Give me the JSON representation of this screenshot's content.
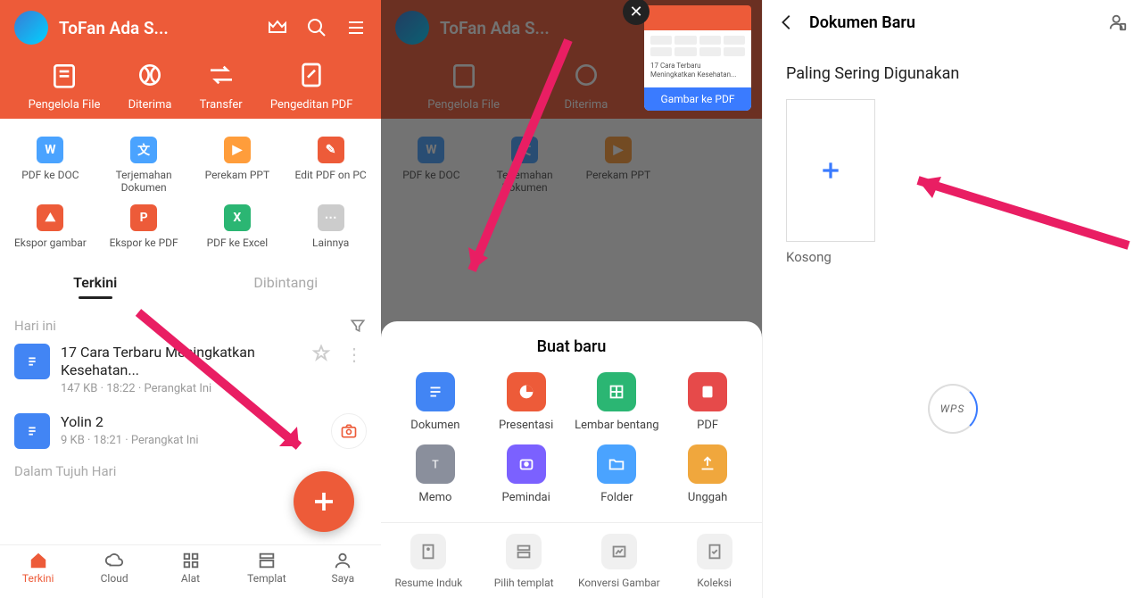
{
  "p1": {
    "username": "ToFan Ada S...",
    "tools": [
      "Pengelola File",
      "Diterima",
      "Transfer",
      "Pengeditan PDF"
    ],
    "converts": [
      "PDF ke DOC",
      "Terjemahan Dokumen",
      "Perekam PPT",
      "Edit PDF on PC",
      "Ekspor gambar",
      "Ekspor ke PDF",
      "PDF ke Excel",
      "Lainnya"
    ],
    "tabA": "Terkini",
    "tabB": "Dibintangi",
    "today": "Hari ini",
    "file1_title": "17 Cara Terbaru Meningkatkan Kesehatan...",
    "file1_meta": "147 KB · 18:22 · Perangkat Ini",
    "file2_title": "Yolin 2",
    "file2_meta": "9 KB · 18:21 · Perangkat Ini",
    "week": "Dalam Tujuh Hari",
    "nav": [
      "Terkini",
      "Cloud",
      "Alat",
      "Templat",
      "Saya"
    ]
  },
  "p2": {
    "username": "ToFan Ada S...",
    "tools": [
      "Pengelola File",
      "Diterima",
      "Transfer"
    ],
    "converts": [
      "PDF ke DOC",
      "Terjemahan Dokumen",
      "Perekam PPT"
    ],
    "mini_btn": "Gambar ke PDF",
    "sheet_title": "Buat baru",
    "create": [
      "Dokumen",
      "Presentasi",
      "Lembar bentang",
      "PDF",
      "Memo",
      "Pemindai",
      "Folder",
      "Unggah"
    ],
    "bottom": [
      "Resume Induk",
      "Pilih templat",
      "Konversi Gambar",
      "Koleksi"
    ]
  },
  "p3": {
    "title": "Dokumen Baru",
    "sub": "Paling Sering Digunakan",
    "blank": "Kosong",
    "wps": "WPS"
  }
}
